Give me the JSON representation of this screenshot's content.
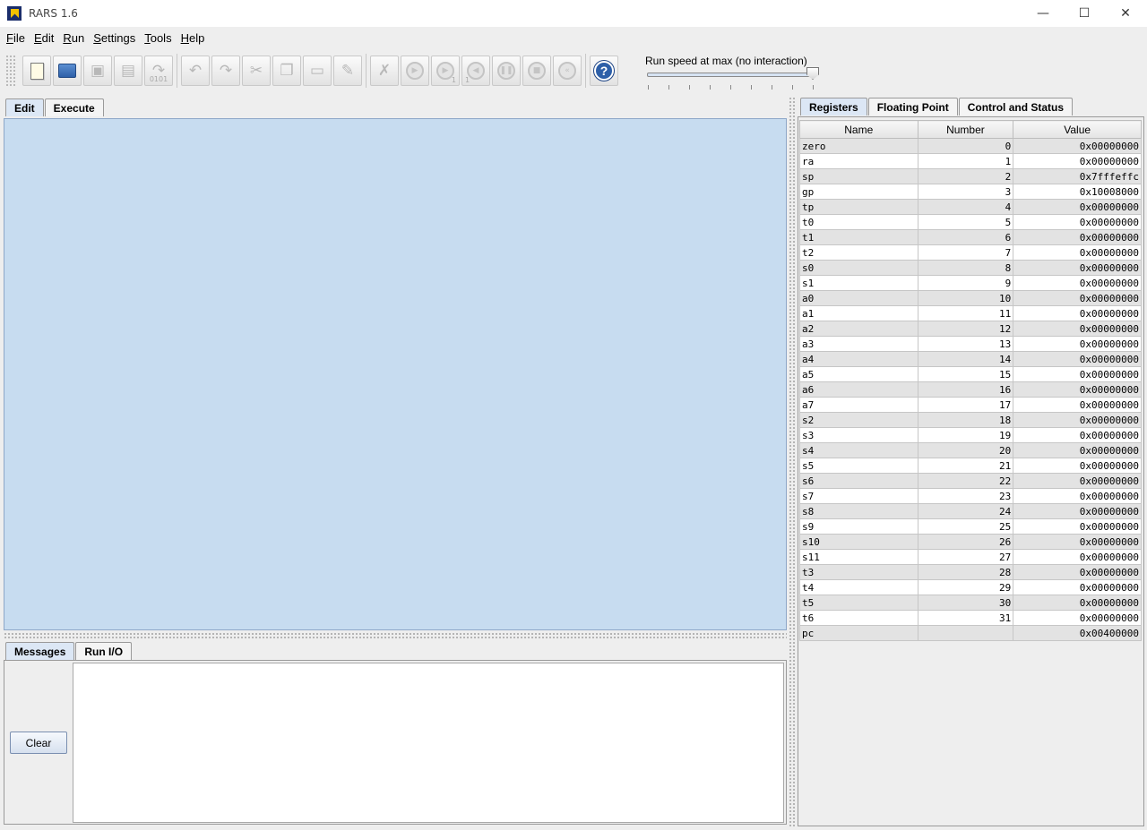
{
  "window": {
    "title": "RARS 1.6",
    "minimize": "—",
    "maximize": "☐",
    "close": "✕"
  },
  "menu": [
    {
      "label": "File"
    },
    {
      "label": "Edit"
    },
    {
      "label": "Run"
    },
    {
      "label": "Settings"
    },
    {
      "label": "Tools"
    },
    {
      "label": "Help"
    }
  ],
  "toolbar": {
    "icons": [
      "new-file-icon",
      "open-file-icon",
      "save-icon",
      "save-as-icon",
      "dump-memory-icon",
      "undo-icon",
      "redo-icon",
      "cut-icon",
      "copy-icon",
      "paste-icon",
      "find-replace-icon",
      "assemble-icon",
      "run-icon",
      "step-icon",
      "backstep-icon",
      "pause-icon",
      "stop-icon",
      "reset-icon",
      "help-icon"
    ],
    "dump_sub": "0101",
    "step_sub": "1",
    "backstep_sub": "1"
  },
  "speed": {
    "label": "Run speed at max (no interaction)",
    "level": 1.0
  },
  "left_tabs": [
    {
      "label": "Edit",
      "active": true
    },
    {
      "label": "Execute",
      "active": false
    }
  ],
  "bottom_tabs": [
    {
      "label": "Messages",
      "active": true
    },
    {
      "label": "Run I/O",
      "active": false
    }
  ],
  "clear_button": "Clear",
  "right_tabs": [
    {
      "label": "Registers",
      "active": true
    },
    {
      "label": "Floating Point",
      "active": false
    },
    {
      "label": "Control and Status",
      "active": false
    }
  ],
  "registers": {
    "headers": [
      "Name",
      "Number",
      "Value"
    ],
    "rows": [
      [
        "zero",
        "0",
        "0x00000000"
      ],
      [
        "ra",
        "1",
        "0x00000000"
      ],
      [
        "sp",
        "2",
        "0x7fffeffc"
      ],
      [
        "gp",
        "3",
        "0x10008000"
      ],
      [
        "tp",
        "4",
        "0x00000000"
      ],
      [
        "t0",
        "5",
        "0x00000000"
      ],
      [
        "t1",
        "6",
        "0x00000000"
      ],
      [
        "t2",
        "7",
        "0x00000000"
      ],
      [
        "s0",
        "8",
        "0x00000000"
      ],
      [
        "s1",
        "9",
        "0x00000000"
      ],
      [
        "a0",
        "10",
        "0x00000000"
      ],
      [
        "a1",
        "11",
        "0x00000000"
      ],
      [
        "a2",
        "12",
        "0x00000000"
      ],
      [
        "a3",
        "13",
        "0x00000000"
      ],
      [
        "a4",
        "14",
        "0x00000000"
      ],
      [
        "a5",
        "15",
        "0x00000000"
      ],
      [
        "a6",
        "16",
        "0x00000000"
      ],
      [
        "a7",
        "17",
        "0x00000000"
      ],
      [
        "s2",
        "18",
        "0x00000000"
      ],
      [
        "s3",
        "19",
        "0x00000000"
      ],
      [
        "s4",
        "20",
        "0x00000000"
      ],
      [
        "s5",
        "21",
        "0x00000000"
      ],
      [
        "s6",
        "22",
        "0x00000000"
      ],
      [
        "s7",
        "23",
        "0x00000000"
      ],
      [
        "s8",
        "24",
        "0x00000000"
      ],
      [
        "s9",
        "25",
        "0x00000000"
      ],
      [
        "s10",
        "26",
        "0x00000000"
      ],
      [
        "s11",
        "27",
        "0x00000000"
      ],
      [
        "t3",
        "28",
        "0x00000000"
      ],
      [
        "t4",
        "29",
        "0x00000000"
      ],
      [
        "t5",
        "30",
        "0x00000000"
      ],
      [
        "t6",
        "31",
        "0x00000000"
      ],
      [
        "pc",
        "",
        "0x00400000"
      ]
    ]
  }
}
